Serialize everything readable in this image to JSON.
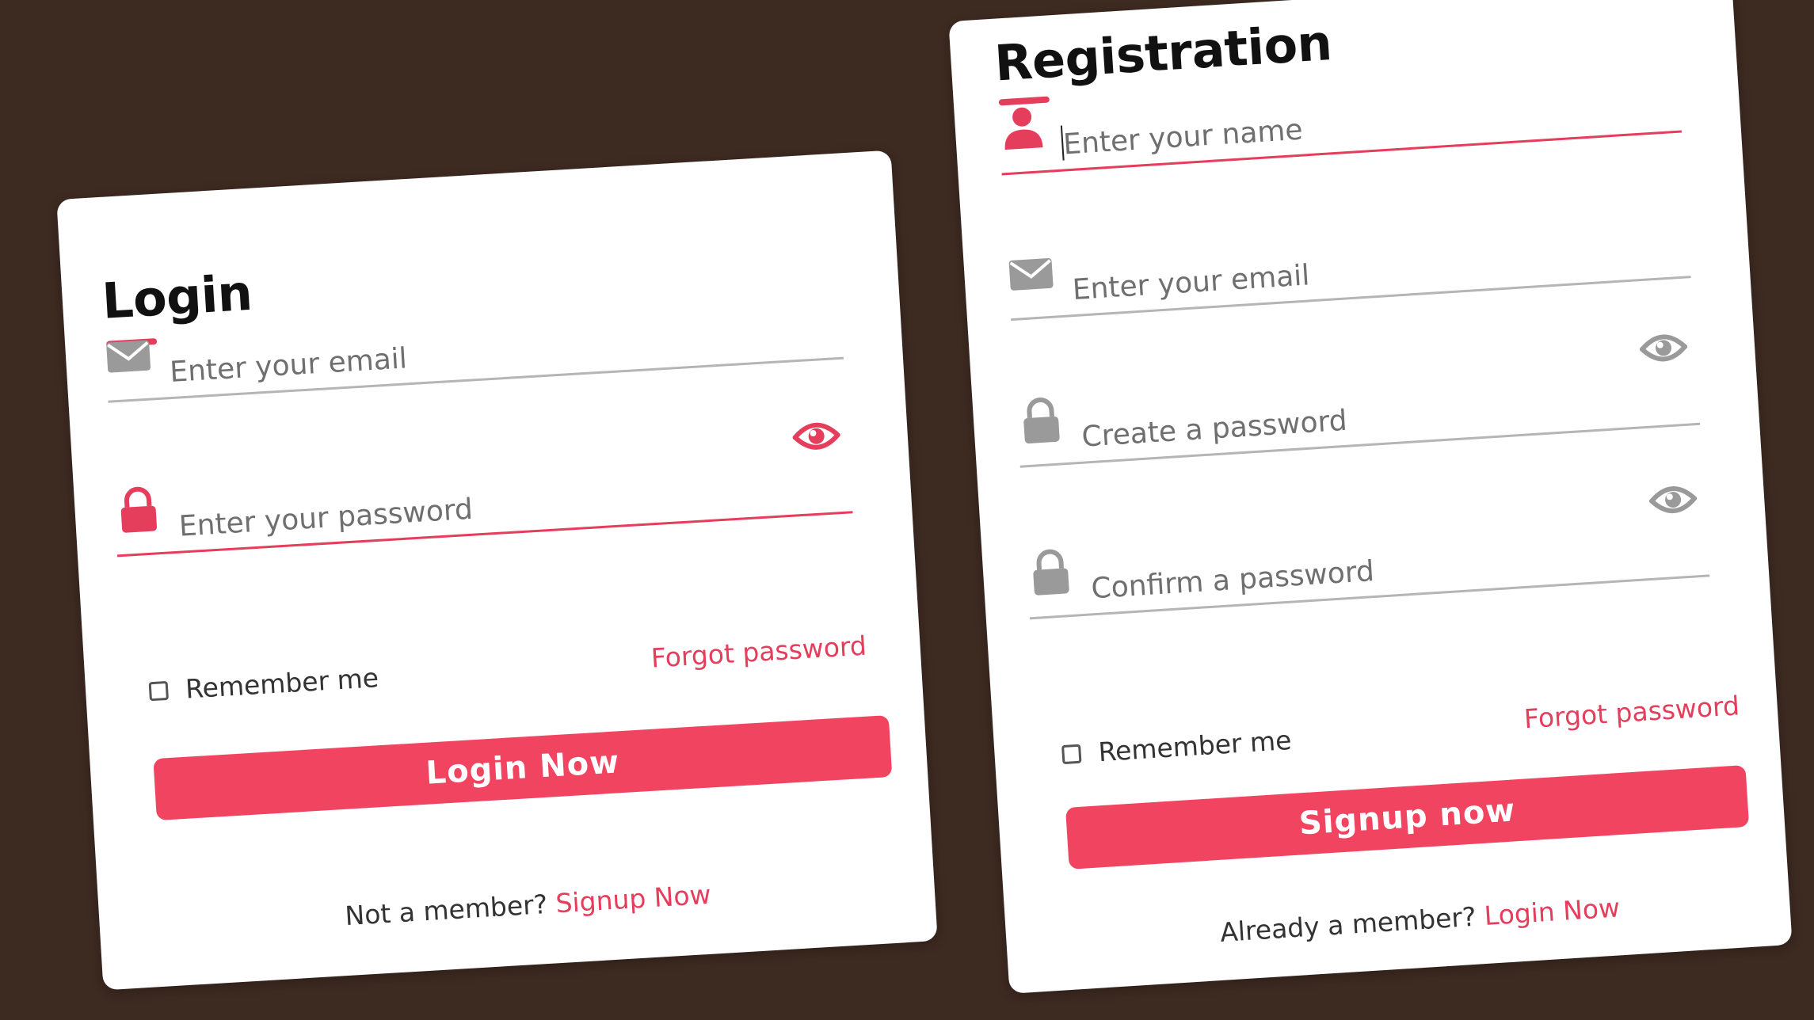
{
  "colors": {
    "background": "#3d2a21",
    "card": "#ffffff",
    "accent": "#e53e5c",
    "button": "#f04461",
    "icon_inactive": "#9a9a9a"
  },
  "login": {
    "title": "Login",
    "email_field": {
      "placeholder": "Enter your email",
      "value": "",
      "icon": "envelope-icon"
    },
    "password_field": {
      "placeholder": "Enter your password",
      "value": "",
      "icon": "lock-icon",
      "toggle_icon": "eye-icon"
    },
    "remember_label": "Remember me",
    "remember_checked": false,
    "forgot_label": "Forgot password",
    "submit_label": "Login Now",
    "footer_prompt": "Not a member?",
    "footer_link": "Signup Now"
  },
  "registration": {
    "title": "Registration",
    "name_field": {
      "placeholder": "Enter your name",
      "value": "",
      "icon": "user-icon"
    },
    "email_field": {
      "placeholder": "Enter your email",
      "value": "",
      "icon": "envelope-icon"
    },
    "password_field": {
      "placeholder": "Create a password",
      "value": "",
      "icon": "lock-icon",
      "toggle_icon": "eye-icon"
    },
    "confirm_field": {
      "placeholder": "Confirm a password",
      "value": "",
      "icon": "lock-icon",
      "toggle_icon": "eye-icon"
    },
    "remember_label": "Remember me",
    "remember_checked": false,
    "forgot_label": "Forgot password",
    "submit_label": "Signup now",
    "footer_prompt": "Already a member?",
    "footer_link": "Login Now"
  }
}
